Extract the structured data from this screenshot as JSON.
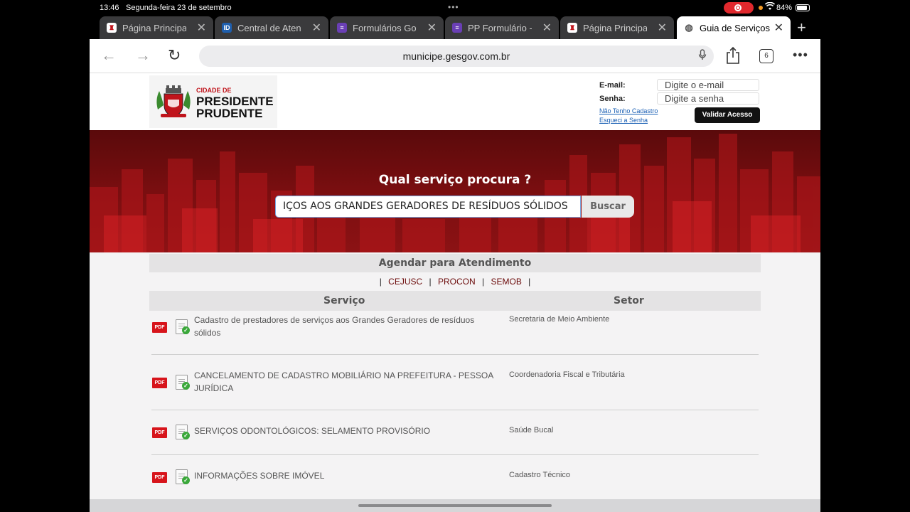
{
  "status_bar": {
    "time": "13:46",
    "date": "Segunda-feira 23 de setembro",
    "battery": "84%"
  },
  "tabs": [
    {
      "label": "Página Principal -",
      "icon": "site-crest-icon",
      "active": false
    },
    {
      "label": "Central de Atendi",
      "icon": "id-icon",
      "active": false
    },
    {
      "label": "Formulários Goog",
      "icon": "forms-icon",
      "active": false
    },
    {
      "label": "PP Formulário - C",
      "icon": "forms-icon",
      "active": false
    },
    {
      "label": "Página Principal -",
      "icon": "site-crest-icon",
      "active": false
    },
    {
      "label": "Guia de Serviços",
      "icon": "globe-icon",
      "active": true
    }
  ],
  "toolbar": {
    "url": "municipe.gesgov.com.br",
    "tab_count": "6"
  },
  "header": {
    "logo_line1": "CIDADE DE",
    "logo_line2": "PRESIDENTE",
    "logo_line3": "PRUDENTE",
    "email_label": "E-mail:",
    "email_placeholder": "Digite o e-mail",
    "senha_label": "Senha:",
    "senha_placeholder": "Digite a senha",
    "link_cadastro": "Não Tenho Cadastro",
    "link_senha": "Esqueci a Senha",
    "validar_label": "Validar Acesso"
  },
  "hero": {
    "question": "Qual serviço procura ?",
    "search_value": "IÇOS AOS GRANDES GERADORES DE RESÍDUOS SÓLIDOS",
    "buscar_label": "Buscar"
  },
  "agendar": {
    "title": "Agendar para Atendimento",
    "links": [
      "CEJUSC",
      "PROCON",
      "SEMOB"
    ]
  },
  "table": {
    "col_servico": "Serviço",
    "col_setor": "Setor",
    "pdf_label": "PDF",
    "rows": [
      {
        "servico": "Cadastro de prestadores de serviços aos Grandes Geradores de resíduos sólidos",
        "setor": "Secretaria de Meio Ambiente"
      },
      {
        "servico": "CANCELAMENTO DE CADASTRO MOBILIÁRIO NA PREFEITURA - PESSOA JURÍDICA",
        "setor": "Coordenadoria Fiscal e Tributária"
      },
      {
        "servico": "SERVIÇOS ODONTOLÓGICOS: SELAMENTO PROVISÓRIO",
        "setor": "Saúde Bucal"
      },
      {
        "servico": "INFORMAÇÕES SOBRE IMÓVEL",
        "setor": "Cadastro Técnico"
      }
    ]
  },
  "colors": {
    "hero_red": "#7a0e10",
    "link_red": "#6b0a0a",
    "pdf_red": "#d7141b",
    "record_red": "#e0282d"
  }
}
